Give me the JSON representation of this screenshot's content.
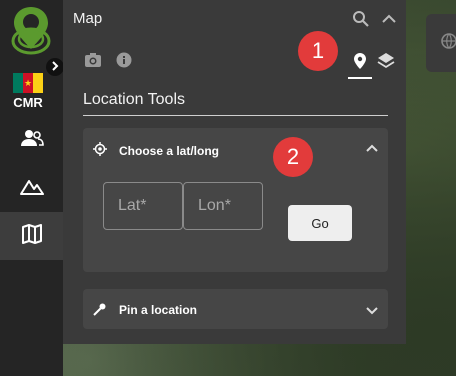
{
  "country": {
    "code": "CMR"
  },
  "panel": {
    "title": "Map",
    "section_title": "Location Tools"
  },
  "latlong_card": {
    "title": "Choose a lat/long",
    "lat_placeholder": "Lat*",
    "lon_placeholder": "Lon*",
    "go_label": "Go"
  },
  "pin_card": {
    "title": "Pin a location"
  },
  "annotations": {
    "badge_1": "1",
    "badge_2": "2"
  },
  "icons": {
    "logo": "app-logo",
    "expand": "chevron-right-icon",
    "rail": [
      "people-icon",
      "mountain-icon",
      "map-icon"
    ],
    "header": [
      "search-icon",
      "chevron-up-icon"
    ],
    "tabs": [
      "camera-icon",
      "info-icon",
      "location-pin-icon",
      "layers-icon"
    ],
    "map_tool": "globe-icon"
  },
  "colors": {
    "rail_bg": "#252525",
    "panel_bg": "#3a3a3a",
    "card_bg": "#464646",
    "badge": "#e23b3b",
    "logo_green": "#5b9a2e",
    "flag": [
      "#007a5e",
      "#ce1126",
      "#fcd116"
    ]
  }
}
